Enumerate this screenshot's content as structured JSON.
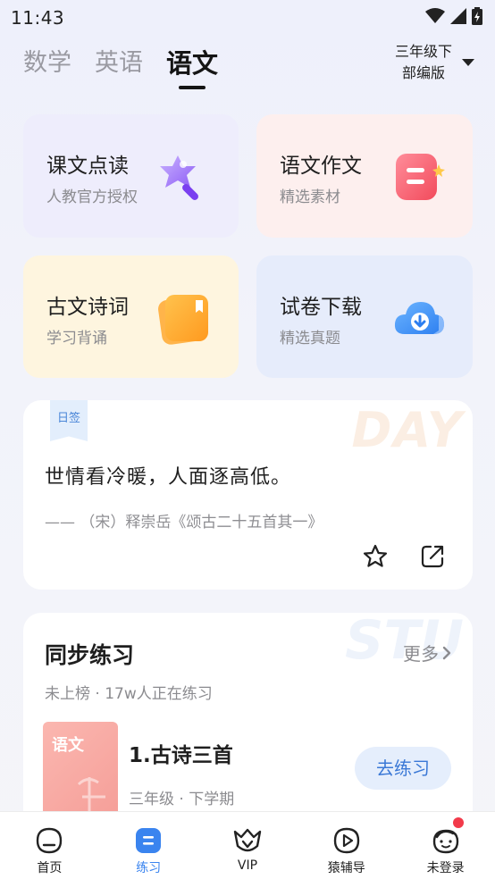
{
  "status": {
    "time": "11:43"
  },
  "tabs": [
    {
      "label": "数学",
      "active": false
    },
    {
      "label": "英语",
      "active": false
    },
    {
      "label": "语文",
      "active": true
    }
  ],
  "grade": {
    "line1": "三年级下",
    "line2": "部编版"
  },
  "cards": [
    {
      "title": "课文点读",
      "sub": "人教官方授权",
      "icon": "magic-wand-icon",
      "bg": "#eeedfc"
    },
    {
      "title": "语文作文",
      "sub": "精选素材",
      "icon": "essay-icon",
      "bg": "#fdefee"
    },
    {
      "title": "古文诗词",
      "sub": "学习背诵",
      "icon": "book-icon",
      "bg": "#fef5df"
    },
    {
      "title": "试卷下载",
      "sub": "精选真题",
      "icon": "cloud-download-icon",
      "bg": "#e6ecfb"
    }
  ],
  "daily": {
    "tag": "日签",
    "watermark": "DAY",
    "text": "世情看冷暖，人面逐高低。",
    "source": "—— （宋）释崇岳《颂古二十五首其一》"
  },
  "practice": {
    "watermark": "STU",
    "title": "同步练习",
    "more": "更多",
    "sub": "未上榜 · 17w人正在练习",
    "book_label": "语文",
    "lesson_title": "1.古诗三首",
    "lesson_meta": "三年级 · 下学期",
    "button": "去练习"
  },
  "nav": [
    {
      "label": "首页",
      "icon": "home-icon",
      "active": false
    },
    {
      "label": "练习",
      "icon": "practice-icon",
      "active": true
    },
    {
      "label": "VIP",
      "icon": "vip-icon",
      "active": false
    },
    {
      "label": "猿辅导",
      "icon": "play-icon",
      "active": false
    },
    {
      "label": "未登录",
      "icon": "avatar-icon",
      "active": false
    }
  ],
  "colors": {
    "accent": "#3a84ef",
    "badge": "#f23a4a"
  }
}
